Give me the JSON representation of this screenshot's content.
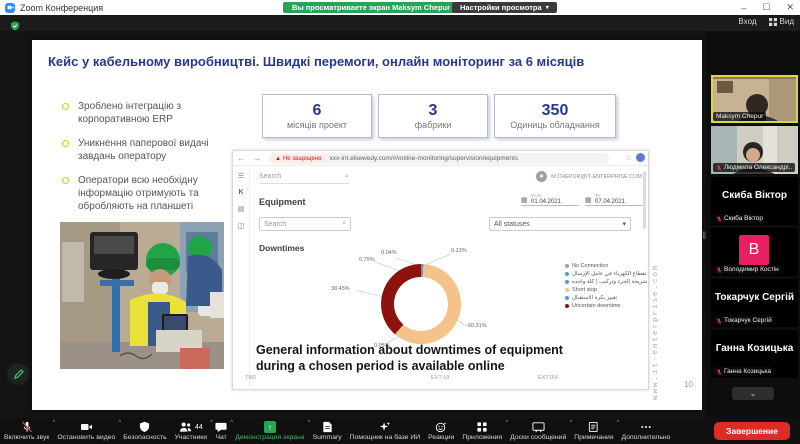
{
  "titlebar": {
    "app_title": "Zoom Конференция",
    "viewing_banner": "Вы просматриваете экран Maksym Chepur",
    "view_settings_button": "Настройки просмотра",
    "minimize": "–",
    "maximize": "☐",
    "close": "✕",
    "login_button": "Вход",
    "view_button": "Вид"
  },
  "slide": {
    "title": "Кейс у кабельному виробництві. Швидкі перемоги, онлайн моніторинг за 6 місяців",
    "bullets": [
      "Зроблено інтеграцію з корпоративною ERP",
      "Уникнення паперової видачі завдань оператору",
      "Оператори всю необхідну інформацію отримують та обробляють на планшеті"
    ],
    "stats": [
      {
        "value": "6",
        "label": "місяців проект"
      },
      {
        "value": "3",
        "label": "фабрики"
      },
      {
        "value": "350",
        "label": "Одиниць обладнання"
      }
    ],
    "caption": "General information about downtimes of equipment during a chosen period is available online",
    "watermark": "www.it-enterprise.com",
    "page_number": "10"
  },
  "browser": {
    "security_badge": "Не защищено",
    "url": "xxx-int.elsewedy.com/#/online-monitoring/supervision/equipments",
    "top_search_placeholder": "Search",
    "user_email": "m.chepur@it-enterprise.com",
    "page_title": "Equipment",
    "date_from_label": "From",
    "date_from_value": "01.04.2021",
    "date_to_label": "To",
    "date_to_value": "07.04.2021",
    "search_placeholder": "Search",
    "status_filter_value": "All statuses",
    "section_title": "Downtimes",
    "equipment_labels": [
      "TM2",
      "EXT-19",
      "EXT164"
    ]
  },
  "chart_data": {
    "type": "pie",
    "donut": true,
    "title": "Downtimes",
    "legend_position": "right",
    "segments": [
      {
        "label": "No Connection",
        "value": 0.04,
        "color": "#a0a0a0"
      },
      {
        "label": "انقطاع الكهرباء في عامل الإرسال",
        "value": 0.13,
        "color": "#5b9bd5"
      },
      {
        "label": "تغيير شريحة الجزء وتركيب ( كلة واحدة",
        "value": 0.79,
        "color": "#5b9bd5"
      },
      {
        "label": "Short stop",
        "value": 60.31,
        "color": "#f5c28a"
      },
      {
        "label": "تغيير بكرة الاستقبال",
        "value": 0.05,
        "color": "#5b9bd5"
      },
      {
        "label": "Uncertain downtime",
        "value": 38.45,
        "color": "#8c140c"
      }
    ],
    "callouts": [
      "0.04%",
      "0.13%",
      "0.79%",
      "38.45%",
      "60.31%",
      "0.05%"
    ]
  },
  "participants": {
    "tiles": [
      {
        "name": "Maksym Chepur"
      },
      {
        "name": "Людмила Олександрі..."
      },
      {
        "name": "Скиба Віктор"
      },
      {
        "name": "Володимир Костін",
        "avatar_letter": "B"
      },
      {
        "name": "Токарчук Сергій"
      },
      {
        "name": "Ганна Козицька"
      }
    ],
    "collapse_chevron": "⌄"
  },
  "toolbar": {
    "items": [
      {
        "label": "Включить звук"
      },
      {
        "label": "Остановить видео"
      },
      {
        "label": "Безопасность"
      },
      {
        "label": "Участники",
        "badge": "44"
      },
      {
        "label": "Чат"
      },
      {
        "label": "Демонстрация экрана"
      },
      {
        "label": "Summary"
      },
      {
        "label": "Помощник на базе ИИ"
      },
      {
        "label": "Реакции"
      },
      {
        "label": "Приложения"
      },
      {
        "label": "Доски сообщений"
      },
      {
        "label": "Примечания"
      },
      {
        "label": "Дополнительно"
      }
    ],
    "end_button": "Завершение"
  }
}
